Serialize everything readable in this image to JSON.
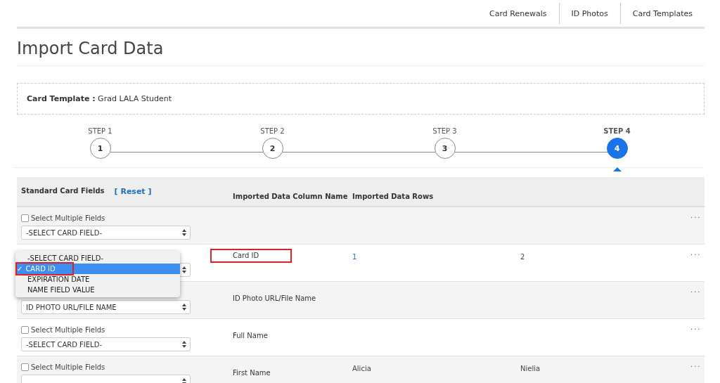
{
  "nav": [
    {
      "label": "Card Renewals"
    },
    {
      "label": "ID Photos"
    },
    {
      "label": "Card Templates"
    }
  ],
  "title": "Import Card Data",
  "template": {
    "label": "Card Template :",
    "value": "Grad LALA Student"
  },
  "steps": [
    {
      "label": "STEP 1",
      "number": "1",
      "selected": false
    },
    {
      "label": "STEP 2",
      "number": "2",
      "selected": false
    },
    {
      "label": "STEP 3",
      "number": "3",
      "selected": false
    },
    {
      "label": "STEP 4",
      "number": "4",
      "selected": true
    }
  ],
  "table": {
    "columns": [
      "Standard Card Fields",
      "Imported Data Column Name",
      "Imported Data Rows"
    ],
    "reset": "[ Reset ]",
    "rows": [
      {
        "multiple_label": "Select Multiple Fields",
        "checked": false,
        "select": "-SELECT CARD FIELD-",
        "values": [],
        "more": "..."
      },
      {
        "column_name": "Card ID",
        "values": [
          "1",
          "2"
        ],
        "highlighted": true,
        "more": "...",
        "dropdown": {
          "options": [
            {
              "label": "-SELECT CARD FIELD-",
              "selected": false,
              "highlighted": false
            },
            {
              "label": "CARD ID",
              "selected": true,
              "highlighted": true
            },
            {
              "label": "EXPIRATION DATE",
              "selected": false,
              "highlighted": false
            },
            {
              "label": "NAME FIELD VALUE",
              "selected": false,
              "highlighted": false
            }
          ],
          "check": "✓"
        }
      },
      {
        "select": "ID PHOTO URL/FILE NAME",
        "column_name": "ID Photo URL/File Name",
        "values": [],
        "highlighted": false,
        "more": "..."
      },
      {
        "multiple_label": "Select Multiple Fields",
        "checked": false,
        "select": "-SELECT CARD FIELD-",
        "column_name": "Full Name",
        "values": [],
        "highlighted": false,
        "more": "..."
      },
      {
        "multiple_label": "Select Multiple Fields",
        "checked": false,
        "column_name": "First Name",
        "values": [
          "Alicia",
          "Nielia"
        ],
        "highlighted": false,
        "more": "..."
      }
    ]
  }
}
